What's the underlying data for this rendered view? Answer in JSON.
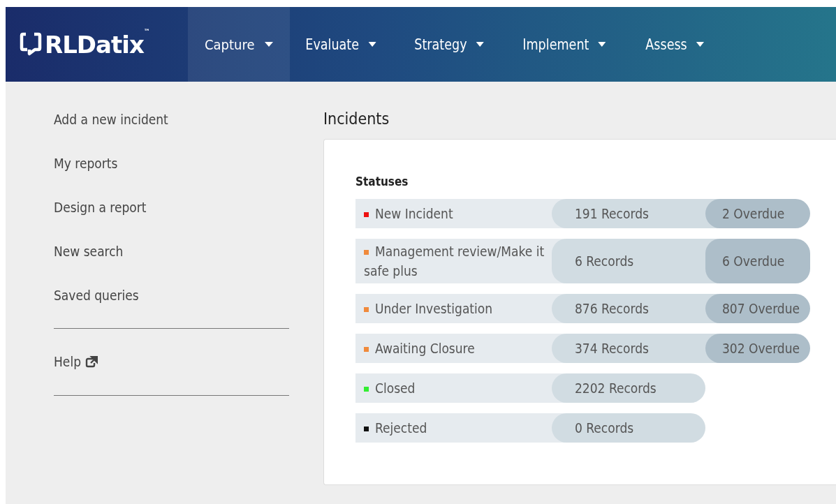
{
  "logo": {
    "text": "RLDatix$^{™}$"
  },
  "nav": [
    {
      "label": "Capture",
      "selected": true
    },
    {
      "label": "Evaluate",
      "selected": false
    },
    {
      "label": "Strategy",
      "selected": false
    },
    {
      "label": "Implement",
      "selected": false
    },
    {
      "label": "Assess",
      "selected": false
    }
  ],
  "sidebar": {
    "items": [
      "Add a new incident",
      "My reports",
      "Design a report",
      "New search",
      "Saved queries"
    ],
    "help": "Help"
  },
  "page_title": "Incidents",
  "statuses": {
    "title": "Statuses",
    "rows": [
      {
        "name": "New Incident",
        "color": "#ee1111",
        "records": "191 Records",
        "overdue": "2 Overdue"
      },
      {
        "name": "Management review/Make it safe plus",
        "color": "#f08a3c",
        "records": "6 Records",
        "overdue": "6 Overdue"
      },
      {
        "name": "Under Investigation",
        "color": "#f08a3c",
        "records": "876 Records",
        "overdue": "807 Overdue"
      },
      {
        "name": "Awaiting Closure",
        "color": "#f08a3c",
        "records": "374 Records",
        "overdue": "302 Overdue"
      },
      {
        "name": "Closed",
        "color": "#33ee33",
        "records": "2202 Records"
      },
      {
        "name": "Rejected",
        "color": "#111111",
        "records": "0 Records"
      }
    ]
  }
}
